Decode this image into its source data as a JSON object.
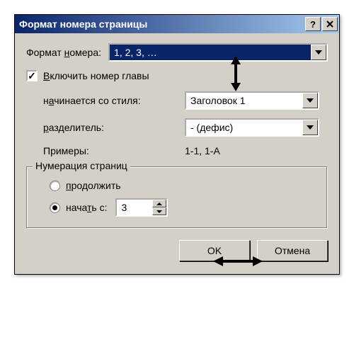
{
  "dialog": {
    "title": "Формат номера страницы"
  },
  "format": {
    "label_pre": "Формат ",
    "label_u": "н",
    "label_post": "омера:",
    "value": "1, 2, 3, …"
  },
  "include_chapter": {
    "label_pre": "",
    "label_u": "В",
    "label_post": "ключить номер главы",
    "checked": true
  },
  "starts_with_style": {
    "label_pre": "н",
    "label_u": "а",
    "label_post": "чинается со стиля:",
    "value": "Заголовок 1"
  },
  "separator": {
    "label_pre": "",
    "label_u": "р",
    "label_post": "азделитель:",
    "value": "-   (дефис)"
  },
  "examples": {
    "label": "Примеры:",
    "value": "1-1, 1-A"
  },
  "numbering": {
    "legend": "Нумерация страниц",
    "continue": {
      "label_pre": "",
      "label_u": "п",
      "label_post": "родолжить",
      "selected": false
    },
    "start_at": {
      "label_pre": "нача",
      "label_u": "т",
      "label_post": "ь с:",
      "selected": true,
      "value": "3"
    }
  },
  "buttons": {
    "ok": "OK",
    "cancel": "Отмена"
  }
}
